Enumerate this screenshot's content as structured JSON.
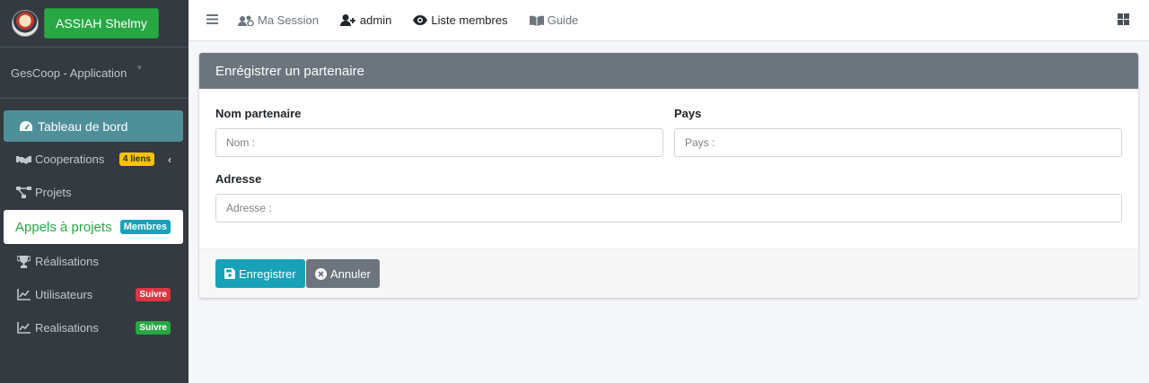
{
  "sidebar": {
    "user_button": "ASSIAH Shelmy",
    "app_name": "GesCoop - Application",
    "items": [
      {
        "label": "Tableau de bord",
        "icon": "tachometer-icon"
      },
      {
        "label": "Cooperations",
        "icon": "handshake-icon",
        "badge": "4 liens"
      },
      {
        "label": "Projets",
        "icon": "project-diagram-icon"
      },
      {
        "label": "Appels à projets",
        "badge": "Membres"
      },
      {
        "label": "Réalisations",
        "icon": "trophy-icon"
      },
      {
        "label": "Utilisateurs",
        "icon": "chart-line-icon",
        "badge": "Suivre"
      },
      {
        "label": "Realisations",
        "icon": "chart-line-icon",
        "badge": "Suivre"
      }
    ]
  },
  "topbar": {
    "session": "Ma Session",
    "admin": "admin",
    "members": "Liste membres",
    "guide": "Guide"
  },
  "form": {
    "title": "Enrégistrer un partenaire",
    "name_label": "Nom partenaire",
    "name_placeholder": "Nom :",
    "country_label": "Pays",
    "country_placeholder": "Pays :",
    "address_label": "Adresse",
    "address_placeholder": "Adresse :",
    "save_label": "Enregistrer",
    "cancel_label": "Annuler"
  },
  "colors": {
    "sidebar_bg": "#343a40",
    "active_item": "#4f8f9a",
    "success": "#28a745",
    "info": "#17a2b8",
    "danger": "#dc3545",
    "warning": "#ffc107",
    "secondary": "#6c757d"
  }
}
